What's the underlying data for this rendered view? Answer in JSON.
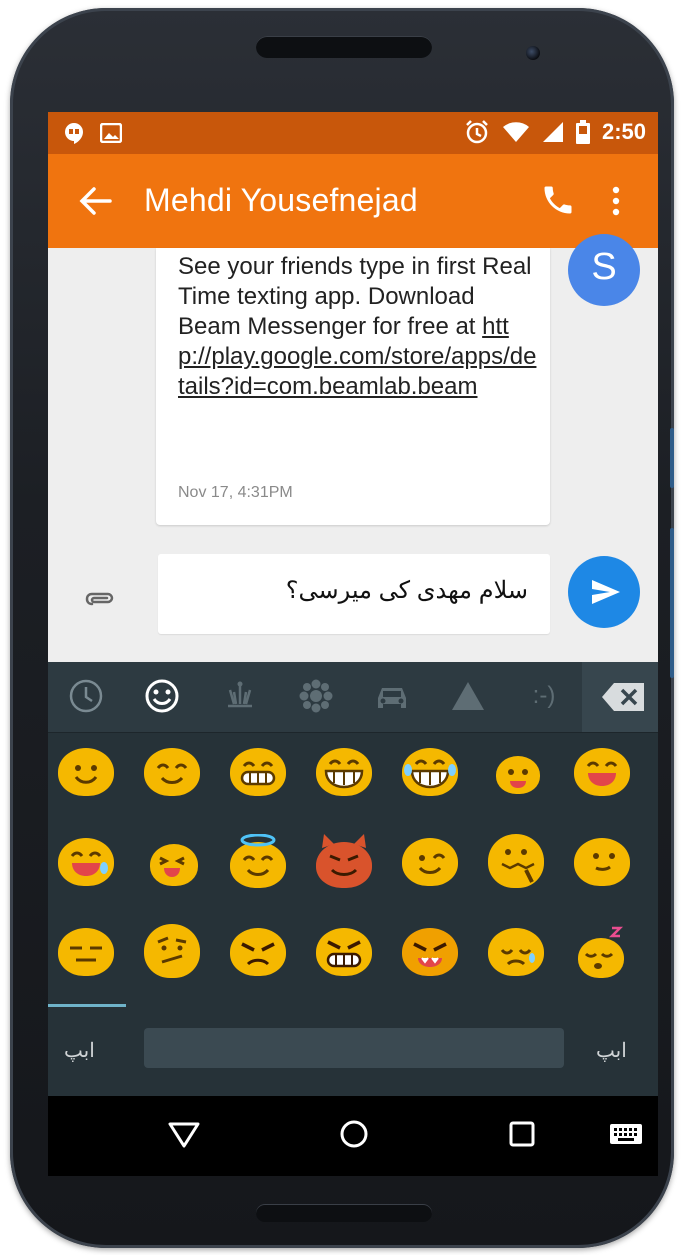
{
  "status_bar": {
    "time": "2:50",
    "icons": [
      "hangouts-icon",
      "image-icon",
      "alarm-icon",
      "wifi-icon",
      "signal-icon",
      "battery-icon"
    ]
  },
  "app_bar": {
    "title": "Mehdi Yousefnejad",
    "icons": [
      "back-arrow-icon",
      "phone-icon",
      "more-vert-icon"
    ]
  },
  "conversation": {
    "message": {
      "text_before_link": "See your friends type in first Real Time texting app. Download Beam Messenger for free at ",
      "link": "http://play.google.com/store/apps/details?id=com.beamlab.beam",
      "timestamp": "Nov 17, 4:31PM"
    },
    "avatar_letter": "S"
  },
  "compose": {
    "text": "سلام مهدی کی میرسی؟",
    "icons": [
      "attach-icon",
      "send-icon"
    ]
  },
  "keyboard": {
    "categories": [
      "recent-icon",
      "smiley-icon",
      "objects-icon",
      "nature-icon",
      "car-icon",
      "symbols-icon",
      "emoticon-icon",
      "backspace-icon"
    ],
    "emoticon_label": ":-)",
    "emoji_rows": [
      [
        "smile",
        "blush",
        "grin",
        "grinning",
        "laughing-tears",
        "smile-small",
        "happy-open"
      ],
      [
        "sweat-smile",
        "squint-laugh",
        "halo",
        "devil",
        "wink",
        "zipper",
        "neutral-smile"
      ],
      [
        "expressionless",
        "confused",
        "angry",
        "grimace-angry",
        "rage",
        "sad",
        "sleeping"
      ]
    ],
    "left_lang": "ابپ",
    "right_lang": "ابپ"
  },
  "nav_bar": {
    "icons": [
      "back-triangle-icon",
      "home-circle-icon",
      "recents-square-icon",
      "keyboard-icon"
    ]
  },
  "colors": {
    "status_bar": "#c8570b",
    "app_bar": "#f0740f",
    "send": "#1e88e5",
    "avatar": "#4a86e8",
    "keyboard": "#263238"
  }
}
